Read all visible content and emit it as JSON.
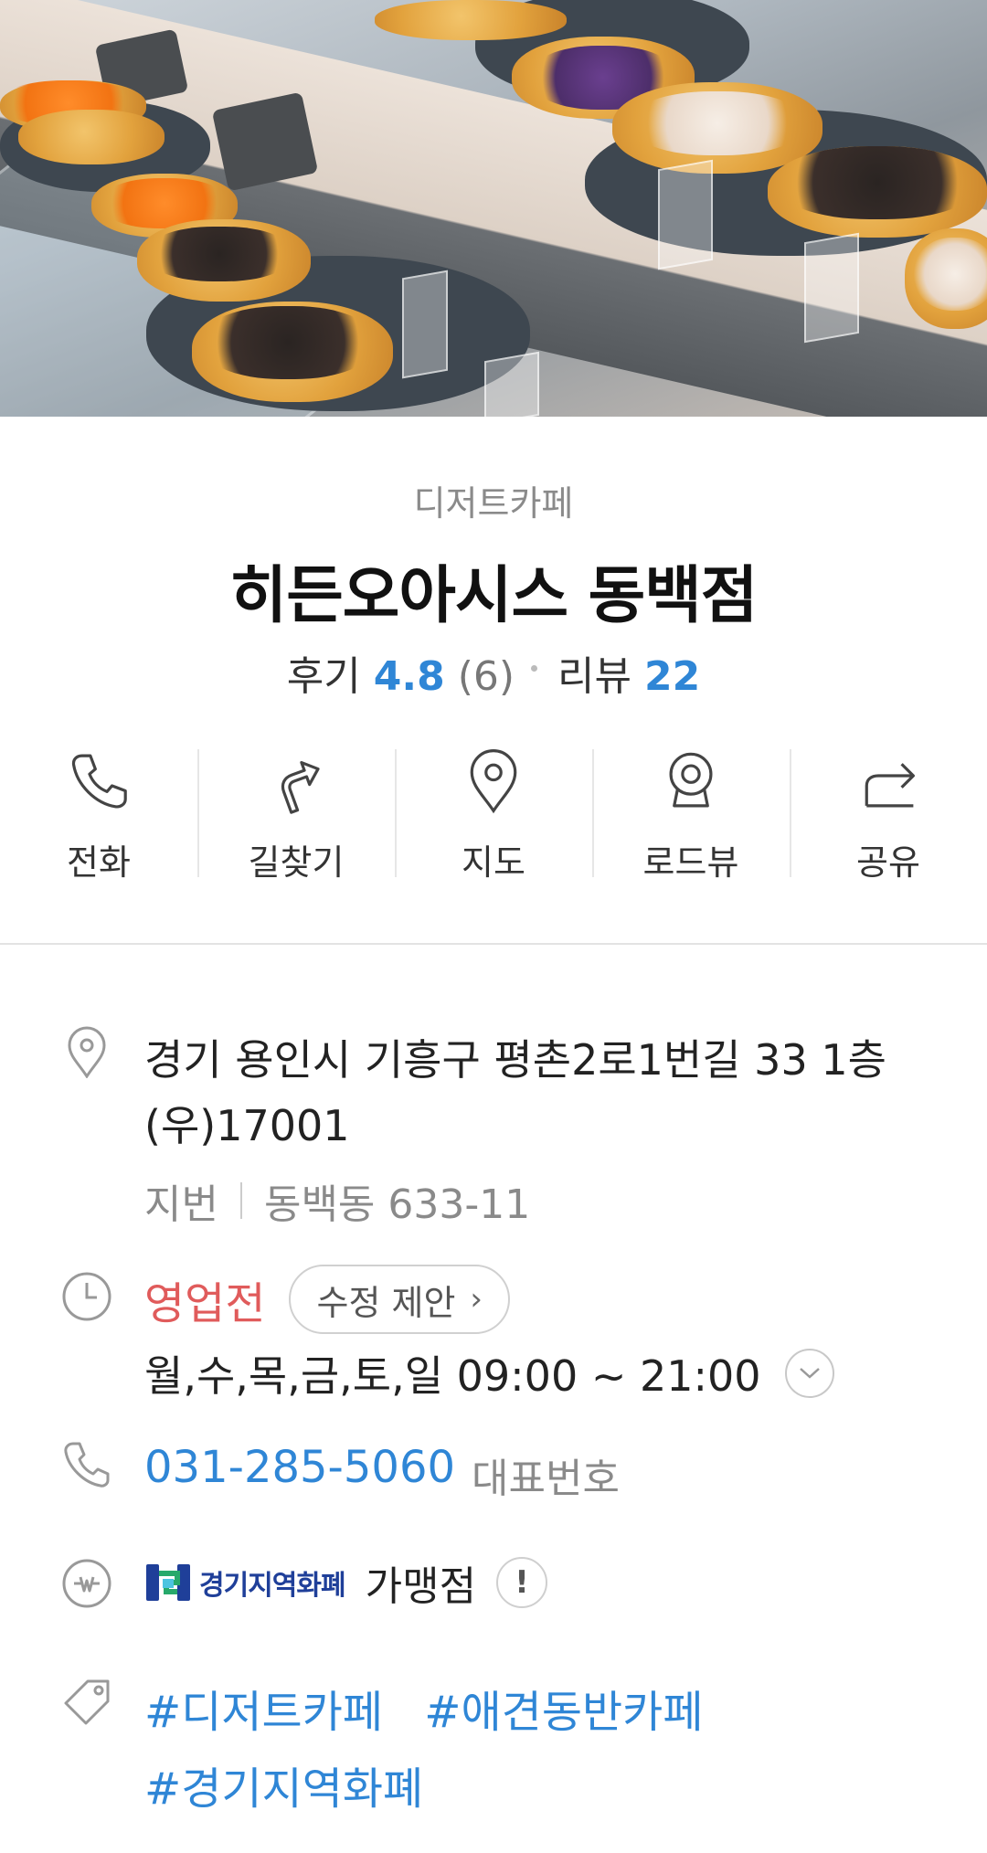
{
  "place": {
    "category": "디저트카페",
    "name": "히든오아시스 동백점",
    "rating_label": "후기",
    "rating_value": "4.8",
    "rating_count": "(6)",
    "review_label": "리뷰",
    "review_count": "22"
  },
  "actions": [
    {
      "label": "전화",
      "icon": "phone-icon"
    },
    {
      "label": "길찾기",
      "icon": "directions-icon"
    },
    {
      "label": "지도",
      "icon": "map-pin-icon"
    },
    {
      "label": "로드뷰",
      "icon": "roadview-icon"
    },
    {
      "label": "공유",
      "icon": "share-icon"
    }
  ],
  "address": {
    "road": "경기 용인시 기흥구 평촌2로1번길 33 1층 (우)17001",
    "jibun_label": "지번",
    "jibun": "동백동 633-11"
  },
  "hours": {
    "status": "영업전",
    "suggest_label": "수정 제안",
    "schedule": "월,수,목,금,토,일 09:00 ~ 21:00"
  },
  "phone": {
    "number": "031-285-5060",
    "tag": "대표번호"
  },
  "payment": {
    "logo_text": "경기지역화폐",
    "label": "가맹점"
  },
  "tags": [
    "#디저트카페",
    "#애견동반카페",
    "#경기지역화폐"
  ],
  "colors": {
    "accent_blue": "#2f86d6",
    "status_red": "#e05b5b"
  }
}
